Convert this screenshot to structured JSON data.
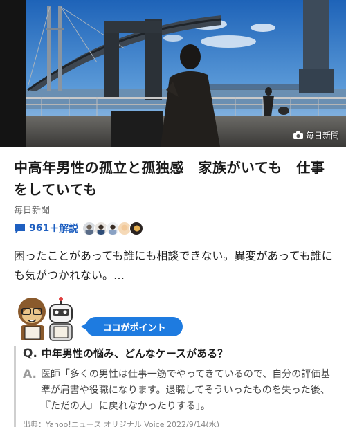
{
  "hero": {
    "photo_credit": "毎日新聞"
  },
  "article": {
    "title": "中高年男性の孤立と孤独感　家族がいても　仕事をしていても",
    "source": "毎日新聞",
    "comment_count": "961",
    "comment_suffix": "＋解説",
    "lead": "困ったことがあっても誰にも相談できない。異変があっても誰にも気がつかれない。…"
  },
  "point": {
    "pill_label": "ココがポイント",
    "q_mark": "Q.",
    "question": "中年男性の悩み、どんなケースがある？",
    "a_mark": "A.",
    "answer": "医師「多くの男性は仕事一筋でやってきているので、自分の評価基準が肩書や役職になります。退職してそういったものを失った後、『ただの人』に戻れなかったりする」。",
    "citation": "出典：Yahoo!ニュース オリジナル Voice 2022/9/14(水)"
  },
  "colors": {
    "accent_blue": "#1e7be0",
    "comment_blue": "#1e5fc0"
  }
}
